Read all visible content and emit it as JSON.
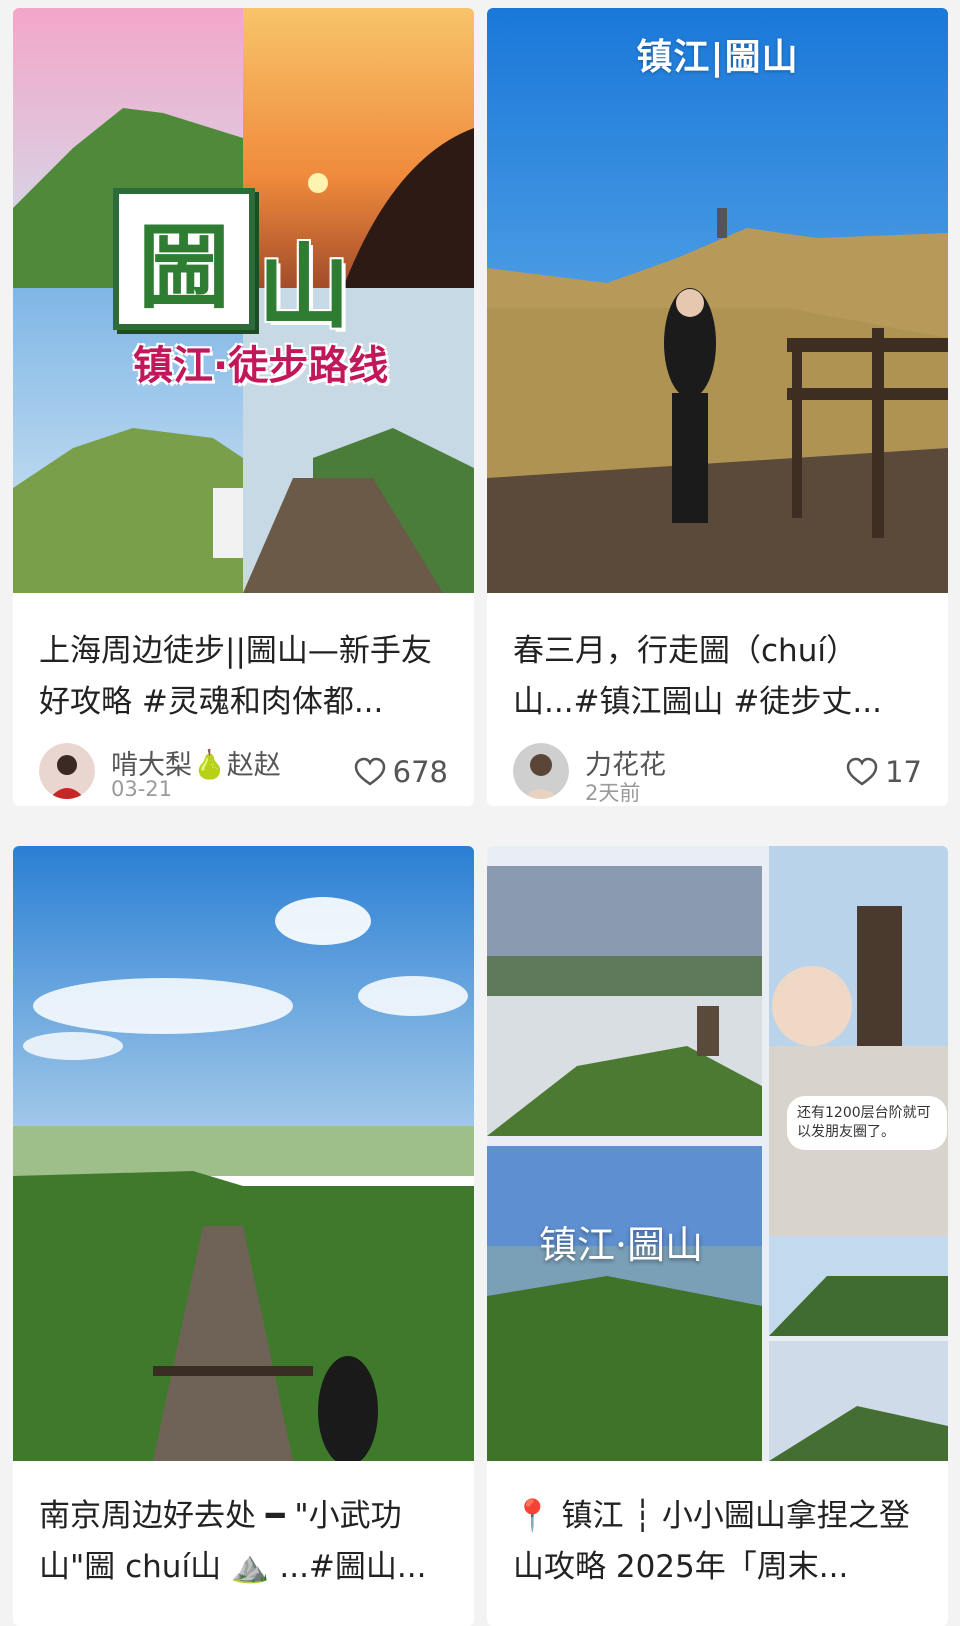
{
  "feed": {
    "cards": [
      {
        "cover": {
          "big_title_a": "圌",
          "big_title_b": "山",
          "subtitle": "镇江·徒步路线"
        },
        "title": "上海周边徒步||圌山—新手友好攻略 #灵魂和肉体都...",
        "author": "啃大梨",
        "author_emoji": "🍐",
        "author_suffix": "赵赵",
        "date": "03-21",
        "likes": "678"
      },
      {
        "cover": {
          "overlay_title": "镇江|圌山"
        },
        "title": "春三月，行走圌（chuí）山...#镇江圌山 #徒步丈...",
        "author": "力花花",
        "date": "2天前",
        "likes": "17"
      },
      {
        "cover": {},
        "title": "南京周边好去处 ━ \"小武功山\"圌 chuí山 ⛰️ ...#圌山..."
      },
      {
        "cover": {
          "collage_text": "镇江·圌山",
          "bubble_text": "还有1200层台阶就可以发朋友圈了。"
        },
        "title": "📍 镇江 ┆ 小小圌山拿捏之登山攻略 2025年「周末..."
      }
    ]
  },
  "colors": {
    "background": "#f3f3f3",
    "card": "#ffffff",
    "title_text": "#222222",
    "meta_text": "#555555",
    "date_text": "#9a9a9a",
    "accent_green": "#2e7d32",
    "accent_pink": "#c2185b"
  },
  "icons": [
    "heart-outline-icon",
    "avatar-photo",
    "pin-icon",
    "mountain-emoji"
  ]
}
